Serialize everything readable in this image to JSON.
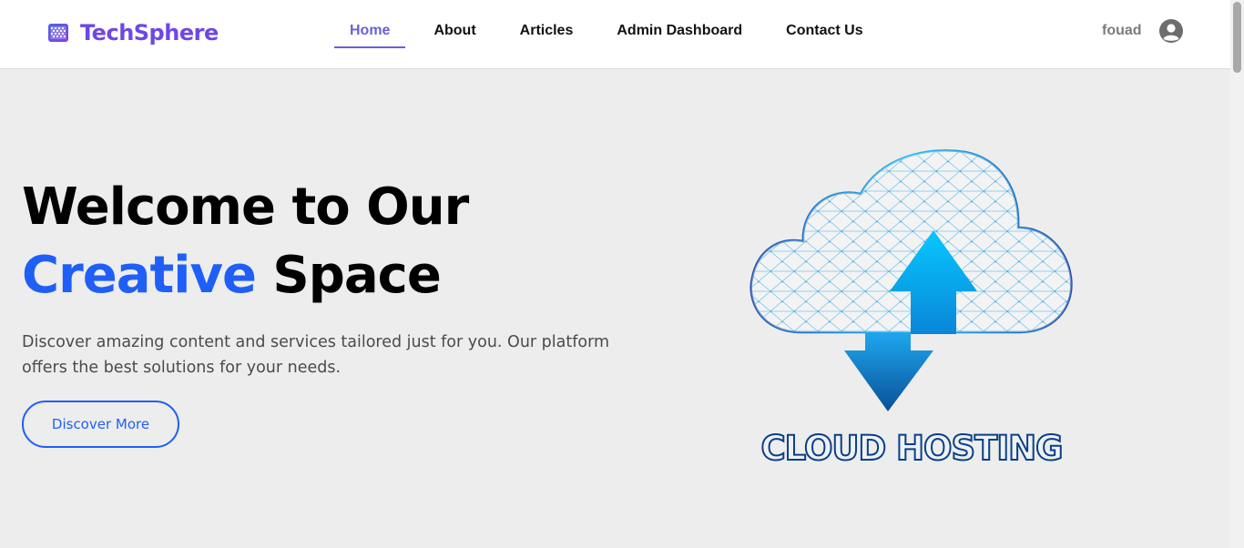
{
  "brand": {
    "name": "TechSphere",
    "icon": "grid-logo-icon"
  },
  "nav": {
    "links": [
      {
        "label": "Home",
        "active": true
      },
      {
        "label": "About"
      },
      {
        "label": "Articles"
      },
      {
        "label": "Admin Dashboard"
      },
      {
        "label": "Contact Us"
      }
    ]
  },
  "user": {
    "name": "fouad",
    "icon": "user-avatar-icon"
  },
  "hero": {
    "title_line1": "Welcome to Our",
    "title_accent": "Creative",
    "title_rest": " Space",
    "description": "Discover amazing content and services tailored just for you. Our platform offers the best solutions for your needs.",
    "cta_label": "Discover More"
  },
  "illustration": {
    "label": "CLOUD HOSTING",
    "icon": "cloud-upload-download-icon"
  },
  "colors": {
    "accent": "#1f5ff7",
    "brand": "#6f47e6",
    "nav_active": "#6a5fdb"
  }
}
